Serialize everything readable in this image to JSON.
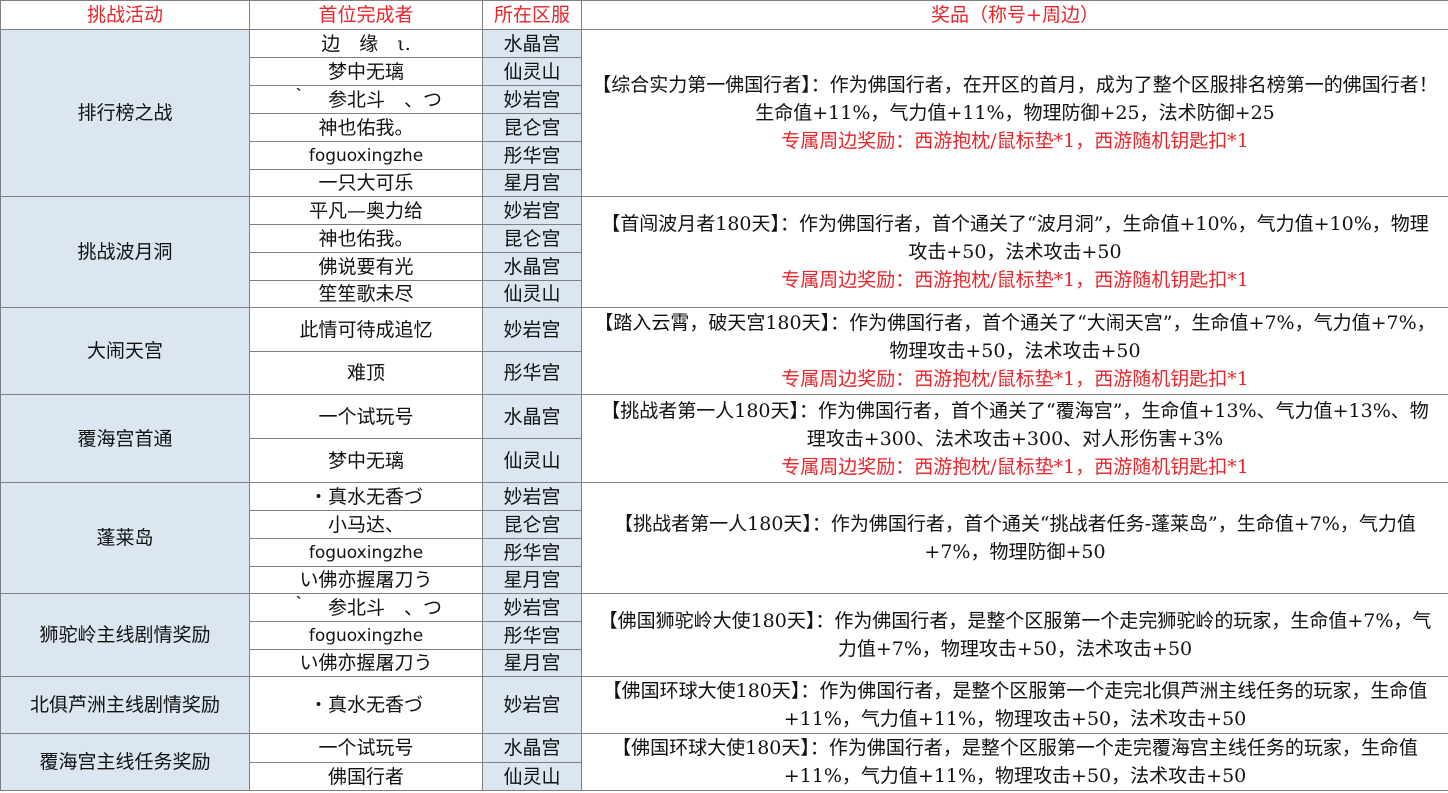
{
  "headers": {
    "activity": "挑战活动",
    "first_finisher": "首位完成者",
    "server": "所在区服",
    "prize": "奖品（称号+周边）"
  },
  "groups": [
    {
      "activity": "排行榜之战",
      "rows": [
        {
          "player": "边　缘　ι.",
          "server": "水晶宫"
        },
        {
          "player": "梦中无璃",
          "server": "仙灵山"
        },
        {
          "player": "｀　参北斗　、つ",
          "server": "妙岩宫"
        },
        {
          "player": "神也佑我。",
          "server": "昆仑宫"
        },
        {
          "player": "foguoxingzhe",
          "server": "彤华宫"
        },
        {
          "player": "一只大可乐",
          "server": "星月宫"
        }
      ],
      "prize": "【综合实力第一佛国行者】：作为佛国行者，在开区的首月，成为了整个区服排名榜第一的佛国行者！生命值+11%，气力值+11%，物理防御+25，法术防御+25",
      "merch": "专属周边奖励：西游抱枕/鼠标垫*1，西游随机钥匙扣*1"
    },
    {
      "activity": "挑战波月洞",
      "rows": [
        {
          "player": "平凡—奥力给",
          "server": "妙岩宫"
        },
        {
          "player": "神也佑我。",
          "server": "昆仑宫"
        },
        {
          "player": "佛说要有光",
          "server": "水晶宫"
        },
        {
          "player": "笙笙歌未尽",
          "server": "仙灵山"
        }
      ],
      "prize": "【首闯波月者180天】：作为佛国行者，首个通关了“波月洞”，生命值+10%，气力值+10%，物理攻击+50，法术攻击+50",
      "merch": "专属周边奖励：西游抱枕/鼠标垫*1，西游随机钥匙扣*1"
    },
    {
      "activity": "大闹天宫",
      "rows": [
        {
          "player": "此情可待成追忆",
          "server": "妙岩宫"
        },
        {
          "player": "难顶",
          "server": "彤华宫"
        }
      ],
      "prize": "【踏入云霄，破天宫180天】：作为佛国行者，首个通关了“大闹天宫”，生命值+7%，气力值+7%，物理攻击+50，法术攻击+50",
      "merch": "专属周边奖励：西游抱枕/鼠标垫*1，西游随机钥匙扣*1"
    },
    {
      "activity": "覆海宫首通",
      "rows": [
        {
          "player": "一个试玩号",
          "server": "水晶宫"
        },
        {
          "player": "梦中无璃",
          "server": "仙灵山"
        }
      ],
      "prize": "【挑战者第一人180天】：作为佛国行者，首个通关了“覆海宫”，生命值+13%、气力值+13%、物理攻击+300、法术攻击+300、对人形伤害+3%",
      "merch": "专属周边奖励：西游抱枕/鼠标垫*1，西游随机钥匙扣*1"
    },
    {
      "activity": "蓬莱岛",
      "rows": [
        {
          "player": "・真水无香づ",
          "server": "妙岩宫"
        },
        {
          "player": "小马达、",
          "server": "昆仑宫"
        },
        {
          "player": "foguoxingzhe",
          "server": "彤华宫"
        },
        {
          "player": "い佛亦握屠刀う",
          "server": "星月宫"
        }
      ],
      "prize": "【挑战者第一人180天】：作为佛国行者，首个通关“挑战者任务-蓬莱岛”，生命值+7%，气力值+7%，物理防御+50",
      "merch": ""
    },
    {
      "activity": "狮驼岭主线剧情奖励",
      "rows": [
        {
          "player": "｀　参北斗　、つ",
          "server": "妙岩宫"
        },
        {
          "player": "foguoxingzhe",
          "server": "彤华宫"
        },
        {
          "player": "い佛亦握屠刀う",
          "server": "星月宫"
        }
      ],
      "prize": "【佛国狮驼岭大使180天】：作为佛国行者，是整个区服第一个走完狮驼岭的玩家，生命值+7%，气力值+7%，物理攻击+50，法术攻击+50",
      "merch": ""
    },
    {
      "activity": "北俱芦洲主线剧情奖励",
      "rows": [
        {
          "player": "・真水无香づ",
          "server": "妙岩宫"
        }
      ],
      "prize": "【佛国环球大使180天】：作为佛国行者，是整个区服第一个走完北俱芦洲主线任务的玩家，生命值+11%，气力值+11%，物理攻击+50，法术攻击+50",
      "merch": ""
    },
    {
      "activity": "覆海宫主线任务奖励",
      "rows": [
        {
          "player": "一个试玩号",
          "server": "水晶宫"
        },
        {
          "player": "佛国行者",
          "server": "仙灵山"
        }
      ],
      "prize": "【佛国环球大使180天】：作为佛国行者，是整个区服第一个走完覆海宫主线任务的玩家，生命值+11%，气力值+11%，物理攻击+50，法术攻击+50",
      "merch": ""
    }
  ]
}
